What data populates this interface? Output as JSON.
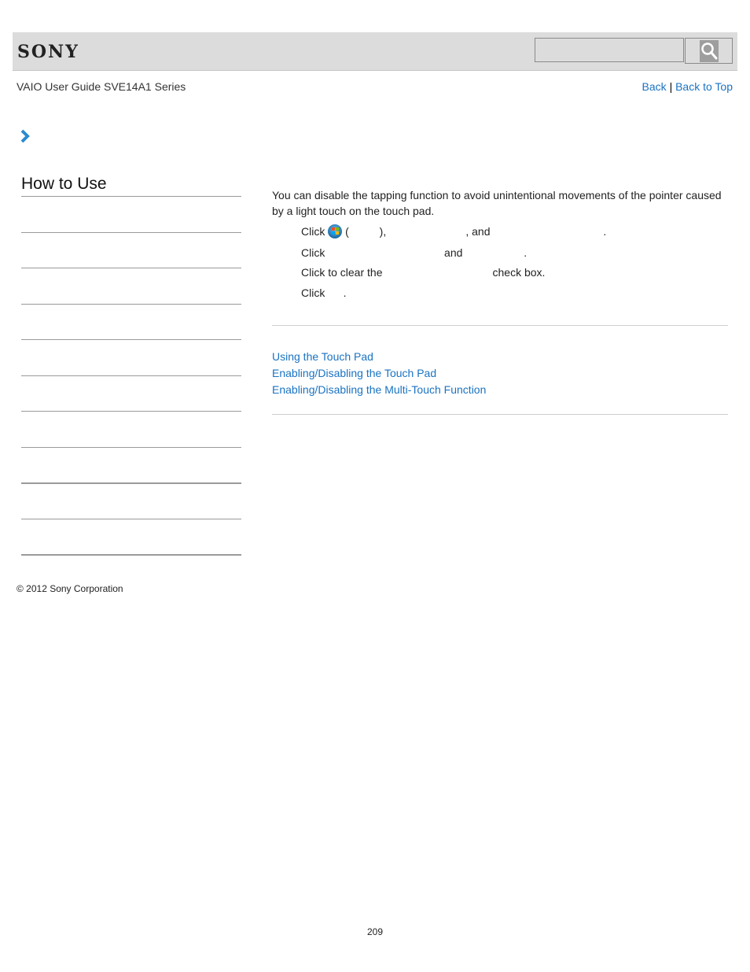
{
  "header": {
    "logo": "SONY",
    "search": {
      "value": "",
      "placeholder": ""
    },
    "search_icon": "search-icon"
  },
  "subheader": {
    "guide_title": "VAIO User Guide SVE14A1 Series",
    "back_label": "Back",
    "separator": "|",
    "back_to_top_label": "Back to Top"
  },
  "breadcrumb": {
    "icon": "chevron-right-icon"
  },
  "sidebar": {
    "title": "How to Use",
    "item_count": 10
  },
  "content": {
    "intro": "You can disable the tapping function to avoid unintentional movements of the pointer caused by a light touch on the touch pad.",
    "steps": [
      {
        "prefix": "Click",
        "icon": "windows-start-icon",
        "rest": " (          ),                          , and                                     ."
      },
      {
        "prefix": "Click",
        "rest": "                                       and                    ."
      },
      {
        "prefix": "Click to clear the",
        "rest": "                                    check box."
      },
      {
        "prefix": "Click",
        "rest": "      ."
      }
    ],
    "related_links": [
      "Using the Touch Pad",
      "Enabling/Disabling the Touch Pad",
      "Enabling/Disabling the Multi-Touch Function"
    ]
  },
  "footer": {
    "copyright": "© 2012 Sony Corporation",
    "page_number": "209"
  },
  "colors": {
    "link": "#1a73c2",
    "header_bg": "#dcdcdc",
    "chevron": "#2a8ad0"
  }
}
